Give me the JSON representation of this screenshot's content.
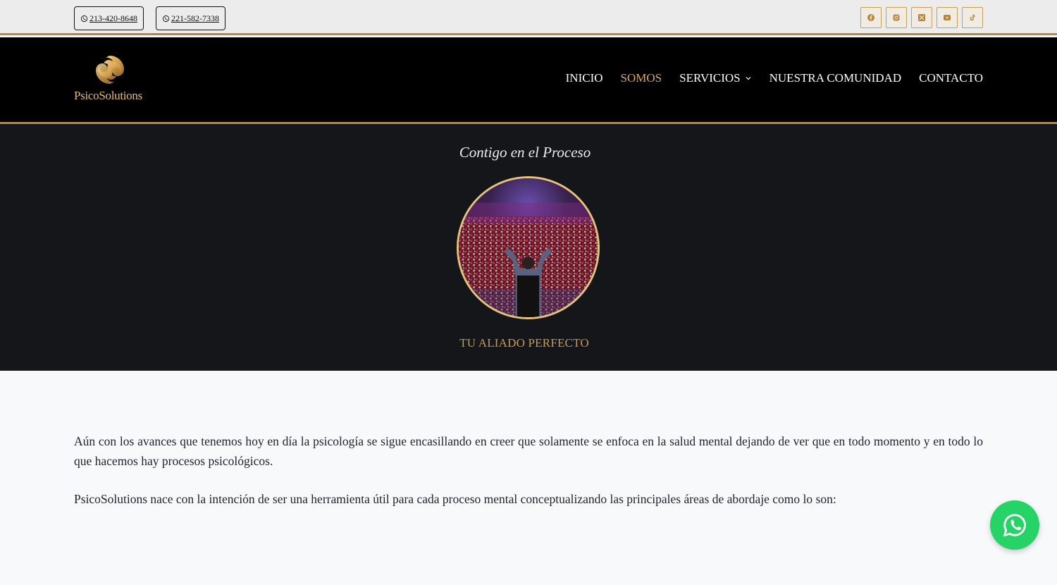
{
  "topbar": {
    "phones": [
      "213-420-8648",
      "221-582-7338"
    ],
    "socials": [
      "facebook-icon",
      "instagram-icon",
      "x-icon",
      "youtube-icon",
      "tiktok-icon"
    ]
  },
  "header": {
    "logo_text": "PsicoSolutions",
    "nav": [
      {
        "label": "INICIO"
      },
      {
        "label": "SOMOS"
      },
      {
        "label": "SERVICIOS"
      },
      {
        "label": "NUESTRA COMUNIDAD"
      },
      {
        "label": "CONTACTO"
      }
    ]
  },
  "hero": {
    "title": "Contigo en el Proceso",
    "subtitle": "TU ALIADO PERFECTO"
  },
  "content": {
    "paragraphs": [
      "Aún con los avances que tenemos hoy en día la psicología se sigue encasillando en creer que solamente se enfoca en la salud mental dejando de ver que en todo momento y en todo lo que hacemos hay procesos psicológicos.",
      "PsicoSolutions nace con la intención de ser una herramienta útil para cada proceso mental conceptualizando las principales áreas de abordaje como lo son:"
    ]
  },
  "colors": {
    "accent": "#b8863b",
    "gold_text": "#d9a862",
    "whatsapp": "#25d366"
  }
}
